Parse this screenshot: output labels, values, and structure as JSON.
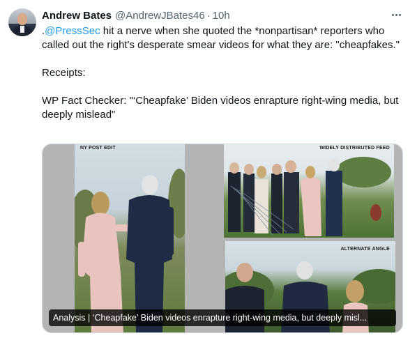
{
  "tweet": {
    "author_name": "Andrew Bates",
    "author_handle": "@AndrewJBates46",
    "separator": "·",
    "time": "10h",
    "mention": "@PressSec",
    "text_lead": ".",
    "text_line1_rest": " hit a nerve when she quoted the *nonpartisan* reporters who called out the right's desperate smear videos for what they are: \"cheapfakes.\"",
    "receipts": "Receipts:",
    "fact_check": "WP Fact Checker: \"‘Cheapfake’ Biden videos enrapture right-wing media, but deeply mislead\""
  },
  "media": {
    "caption_left": "NY POST EDIT",
    "caption_top_right": "WIDELY DISTRIBUTED FEED",
    "caption_bottom_right": "ALTERNATE ANGLE",
    "link_title": "Analysis | ‘Cheapfake’ Biden videos enrapture right-wing media, but deeply misl..."
  },
  "icons": {
    "more": "more-dots-icon"
  }
}
